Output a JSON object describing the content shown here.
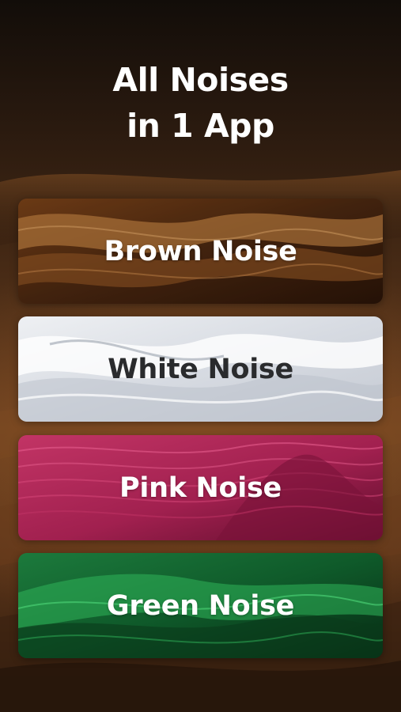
{
  "headline": {
    "line1": "All Noises",
    "line2": "in 1 App"
  },
  "cards": [
    {
      "label": "Brown Noise",
      "colors": {
        "base": "#4a2710",
        "light": "#c98745",
        "dark": "#2a1408"
      }
    },
    {
      "label": "White Noise",
      "colors": {
        "base": "#d7dbe2",
        "light": "#f4f6f8",
        "dark": "#a7adb8"
      }
    },
    {
      "label": "Pink Noise",
      "colors": {
        "base": "#a1204f",
        "light": "#d7487a",
        "dark": "#5e0d2c"
      }
    },
    {
      "label": "Green Noise",
      "colors": {
        "base": "#0f5a2a",
        "light": "#2fb45a",
        "dark": "#062a13"
      }
    }
  ]
}
